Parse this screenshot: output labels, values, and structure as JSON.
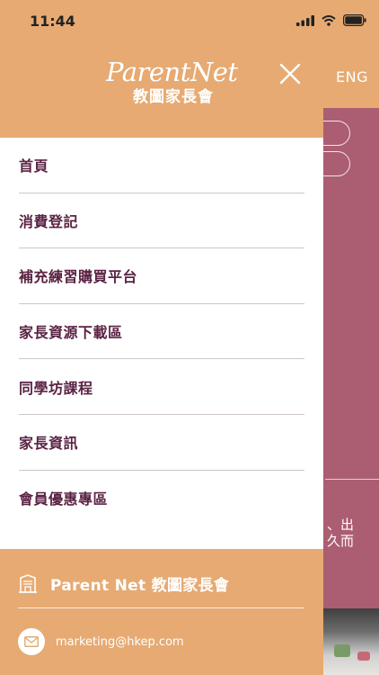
{
  "status_bar": {
    "time": "11:44"
  },
  "background": {
    "lang_label": "ENG",
    "text_line1": "、出",
    "text_line2": "久而"
  },
  "drawer": {
    "logo_en": "ParentNet",
    "logo_zh": "教圖家長會",
    "menu": [
      {
        "label": "首頁"
      },
      {
        "label": "消費登記"
      },
      {
        "label": "補充練習購買平台"
      },
      {
        "label": "家長資源下載區"
      },
      {
        "label": "同學坊課程"
      },
      {
        "label": "家長資訊"
      },
      {
        "label": "會員優惠專區"
      }
    ],
    "footer": {
      "brand": "Parent Net 教圖家長會",
      "email": "marketing@hkep.com"
    }
  },
  "colors": {
    "header": "#e6aa72",
    "background_app": "#ab5d72",
    "menu_text": "#5a2343"
  },
  "icons": [
    "signal-icon",
    "wifi-icon",
    "battery-icon",
    "close-icon",
    "store-icon",
    "mail-icon"
  ]
}
